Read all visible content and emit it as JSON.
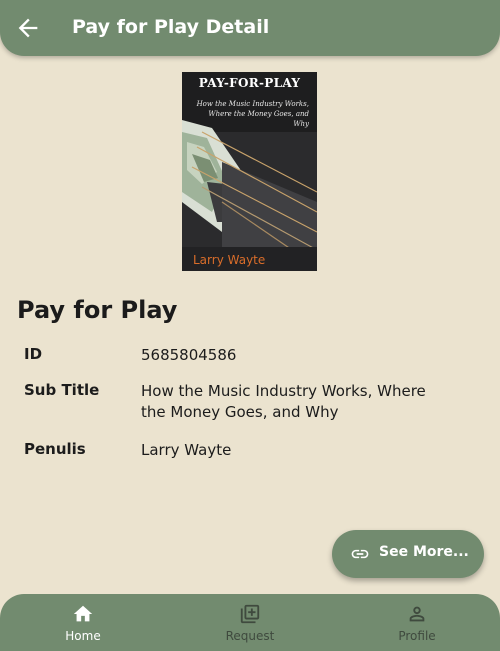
{
  "appbar": {
    "title": "Pay for Play Detail"
  },
  "cover": {
    "title": "PAY-FOR-PLAY",
    "subtitle": "How the Music Industry Works, Where the Money Goes, and Why",
    "author": "Larry Wayte"
  },
  "book": {
    "title": "Pay for Play",
    "details": [
      {
        "label": "ID",
        "value": "5685804586"
      },
      {
        "label": "Sub Title",
        "value": "How the Music Industry Works, Where the Money Goes, and Why"
      },
      {
        "label": "Penulis",
        "value": "Larry Wayte"
      }
    ]
  },
  "fab": {
    "label": "See More..."
  },
  "nav": {
    "items": [
      {
        "label": "Home",
        "icon": "home-icon",
        "active": true
      },
      {
        "label": "Request",
        "icon": "add-box-icon",
        "active": false
      },
      {
        "label": "Profile",
        "icon": "person-icon",
        "active": false
      }
    ]
  },
  "colors": {
    "primary": "#728b6f",
    "background": "#ebe3cf",
    "text": "#1c1c1c",
    "nav_inactive": "#3f4a3e",
    "cover_author": "#d96d2a"
  }
}
